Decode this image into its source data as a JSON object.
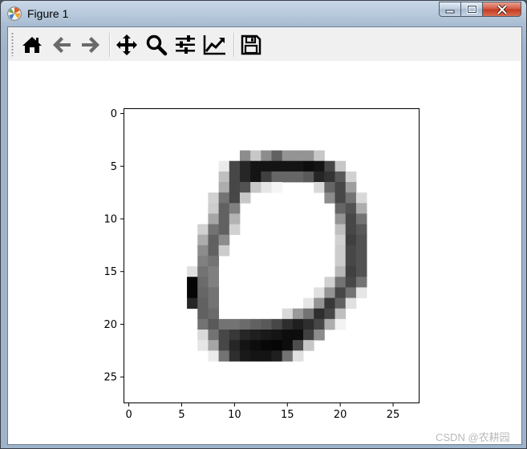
{
  "window": {
    "title": "Figure 1",
    "icon": "matplotlib-icon",
    "buttons": [
      "minimize-button",
      "maximize-button",
      "close-button"
    ]
  },
  "toolbar": {
    "buttons": [
      {
        "name": "home-button",
        "icon": "home-icon"
      },
      {
        "name": "back-button",
        "icon": "arrow-left-icon"
      },
      {
        "name": "forward-button",
        "icon": "arrow-right-icon"
      },
      {
        "name": "pan-button",
        "icon": "move-arrows-icon"
      },
      {
        "name": "zoom-button",
        "icon": "magnifier-icon"
      },
      {
        "name": "subplots-button",
        "icon": "sliders-icon"
      },
      {
        "name": "edit-axes-button",
        "icon": "line-chart-icon"
      },
      {
        "name": "save-button",
        "icon": "floppy-disk-icon"
      }
    ]
  },
  "chart_data": {
    "type": "heatmap",
    "colormap": "gray_r",
    "rows": 28,
    "cols": 28,
    "x_ticks": [
      "0",
      "5",
      "10",
      "15",
      "20",
      "25"
    ],
    "y_ticks": [
      "0",
      "5",
      "10",
      "15",
      "20",
      "25"
    ],
    "xlim": [
      -0.5,
      27.5
    ],
    "ylim": [
      27.5,
      -0.5
    ],
    "pixels": [
      [
        4,
        [
          [
            11,
            0.45
          ],
          [
            12,
            0.22
          ],
          [
            13,
            0.45
          ],
          [
            14,
            0.62
          ],
          [
            15,
            0.42
          ],
          [
            16,
            0.42
          ],
          [
            17,
            0.42
          ],
          [
            18,
            0.22
          ]
        ]
      ],
      [
        5,
        [
          [
            9,
            0.08
          ],
          [
            10,
            0.72
          ],
          [
            11,
            0.85
          ],
          [
            12,
            0.92
          ],
          [
            13,
            0.92
          ],
          [
            14,
            0.92
          ],
          [
            15,
            0.92
          ],
          [
            16,
            0.92
          ],
          [
            17,
            0.95
          ],
          [
            18,
            0.92
          ],
          [
            19,
            0.72
          ],
          [
            20,
            0.22
          ]
        ]
      ],
      [
        6,
        [
          [
            9,
            0.25
          ],
          [
            10,
            0.72
          ],
          [
            11,
            0.85
          ],
          [
            12,
            0.92
          ],
          [
            13,
            0.75
          ],
          [
            14,
            0.6
          ],
          [
            15,
            0.6
          ],
          [
            16,
            0.6
          ],
          [
            17,
            0.65
          ],
          [
            18,
            0.85
          ],
          [
            19,
            0.8
          ],
          [
            20,
            0.65
          ],
          [
            21,
            0.18
          ]
        ]
      ],
      [
        7,
        [
          [
            9,
            0.32
          ],
          [
            10,
            0.72
          ],
          [
            11,
            0.68
          ],
          [
            12,
            0.22
          ],
          [
            13,
            0.1
          ],
          [
            14,
            0.04
          ],
          [
            18,
            0.15
          ],
          [
            19,
            0.6
          ],
          [
            20,
            0.72
          ],
          [
            21,
            0.38
          ]
        ]
      ],
      [
        8,
        [
          [
            8,
            0.18
          ],
          [
            9,
            0.55
          ],
          [
            10,
            0.72
          ],
          [
            11,
            0.22
          ],
          [
            19,
            0.45
          ],
          [
            20,
            0.72
          ],
          [
            21,
            0.55
          ],
          [
            22,
            0.15
          ]
        ]
      ],
      [
        9,
        [
          [
            8,
            0.2
          ],
          [
            9,
            0.62
          ],
          [
            10,
            0.5
          ],
          [
            20,
            0.6
          ],
          [
            21,
            0.68
          ],
          [
            22,
            0.32
          ]
        ]
      ],
      [
        10,
        [
          [
            8,
            0.35
          ],
          [
            9,
            0.62
          ],
          [
            10,
            0.3
          ],
          [
            20,
            0.42
          ],
          [
            21,
            0.72
          ],
          [
            22,
            0.55
          ]
        ]
      ],
      [
        11,
        [
          [
            7,
            0.18
          ],
          [
            8,
            0.55
          ],
          [
            9,
            0.62
          ],
          [
            10,
            0.18
          ],
          [
            20,
            0.25
          ],
          [
            21,
            0.72
          ],
          [
            22,
            0.65
          ]
        ]
      ],
      [
        12,
        [
          [
            7,
            0.32
          ],
          [
            8,
            0.62
          ],
          [
            9,
            0.45
          ],
          [
            20,
            0.18
          ],
          [
            21,
            0.75
          ],
          [
            22,
            0.68
          ]
        ]
      ],
      [
        13,
        [
          [
            7,
            0.45
          ],
          [
            8,
            0.62
          ],
          [
            9,
            0.2
          ],
          [
            20,
            0.2
          ],
          [
            21,
            0.72
          ],
          [
            22,
            0.68
          ]
        ]
      ],
      [
        14,
        [
          [
            7,
            0.5
          ],
          [
            8,
            0.55
          ],
          [
            20,
            0.2
          ],
          [
            21,
            0.72
          ],
          [
            22,
            0.68
          ]
        ]
      ],
      [
        15,
        [
          [
            6,
            0.12
          ],
          [
            7,
            0.55
          ],
          [
            8,
            0.5
          ],
          [
            20,
            0.28
          ],
          [
            21,
            0.75
          ],
          [
            22,
            0.68
          ]
        ]
      ],
      [
        16,
        [
          [
            6,
            0.98
          ],
          [
            7,
            0.58
          ],
          [
            8,
            0.5
          ],
          [
            19,
            0.18
          ],
          [
            20,
            0.55
          ],
          [
            21,
            0.72
          ],
          [
            22,
            0.55
          ]
        ]
      ],
      [
        17,
        [
          [
            6,
            0.98
          ],
          [
            7,
            0.6
          ],
          [
            8,
            0.55
          ],
          [
            18,
            0.12
          ],
          [
            19,
            0.42
          ],
          [
            20,
            0.72
          ],
          [
            21,
            0.55
          ],
          [
            22,
            0.1
          ]
        ]
      ],
      [
        18,
        [
          [
            6,
            0.85
          ],
          [
            7,
            0.62
          ],
          [
            8,
            0.55
          ],
          [
            17,
            0.1
          ],
          [
            18,
            0.42
          ],
          [
            19,
            0.78
          ],
          [
            20,
            0.62
          ],
          [
            21,
            0.12
          ]
        ]
      ],
      [
        19,
        [
          [
            7,
            0.62
          ],
          [
            8,
            0.58
          ],
          [
            15,
            0.15
          ],
          [
            16,
            0.4
          ],
          [
            17,
            0.55
          ],
          [
            18,
            0.82
          ],
          [
            19,
            0.72
          ],
          [
            20,
            0.25
          ]
        ]
      ],
      [
        20,
        [
          [
            7,
            0.55
          ],
          [
            8,
            0.65
          ],
          [
            9,
            0.55
          ],
          [
            10,
            0.55
          ],
          [
            11,
            0.58
          ],
          [
            12,
            0.62
          ],
          [
            13,
            0.65
          ],
          [
            14,
            0.72
          ],
          [
            15,
            0.82
          ],
          [
            16,
            0.88
          ],
          [
            17,
            0.82
          ],
          [
            18,
            0.72
          ],
          [
            19,
            0.32
          ],
          [
            20,
            0.05
          ]
        ]
      ],
      [
        21,
        [
          [
            7,
            0.15
          ],
          [
            8,
            0.55
          ],
          [
            9,
            0.72
          ],
          [
            10,
            0.78
          ],
          [
            11,
            0.85
          ],
          [
            12,
            0.88
          ],
          [
            13,
            0.9
          ],
          [
            14,
            0.92
          ],
          [
            15,
            0.95
          ],
          [
            16,
            0.95
          ],
          [
            17,
            0.75
          ],
          [
            18,
            0.45
          ]
        ]
      ],
      [
        22,
        [
          [
            7,
            0.1
          ],
          [
            8,
            0.35
          ],
          [
            9,
            0.72
          ],
          [
            10,
            0.85
          ],
          [
            11,
            0.92
          ],
          [
            12,
            0.95
          ],
          [
            13,
            0.97
          ],
          [
            14,
            0.98
          ],
          [
            15,
            0.95
          ],
          [
            16,
            0.7
          ],
          [
            17,
            0.22
          ]
        ]
      ],
      [
        23,
        [
          [
            8,
            0.08
          ],
          [
            9,
            0.55
          ],
          [
            10,
            0.82
          ],
          [
            11,
            0.9
          ],
          [
            12,
            0.92
          ],
          [
            13,
            0.92
          ],
          [
            14,
            0.88
          ],
          [
            15,
            0.55
          ],
          [
            16,
            0.12
          ]
        ]
      ]
    ]
  },
  "watermark": "CSDN @农耕园"
}
